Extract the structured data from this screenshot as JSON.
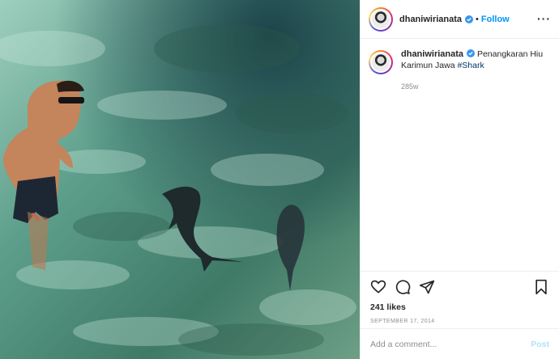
{
  "post": {
    "photo_alt": "Man standing in clear shallow water next to two sharks",
    "username": "dhaniwirianata",
    "verified": true,
    "follow_label": "Follow",
    "more_icon": "more-horizontal-icon",
    "caption_text": "Penangkaran Hiu Karimun Jawa ",
    "hashtag": "#Shark",
    "time_ago": "285w",
    "likes": "241 likes",
    "date": "SEPTEMBER 17, 2014",
    "comment_placeholder": "Add a comment...",
    "post_label": "Post"
  },
  "icons": {
    "like": "heart-icon",
    "comment": "comment-icon",
    "share": "send-icon",
    "save": "bookmark-icon",
    "verified": "verified-badge-icon"
  },
  "colors": {
    "accent": "#0095f6",
    "verified": "#3897f0",
    "water": "#4a8f80"
  }
}
